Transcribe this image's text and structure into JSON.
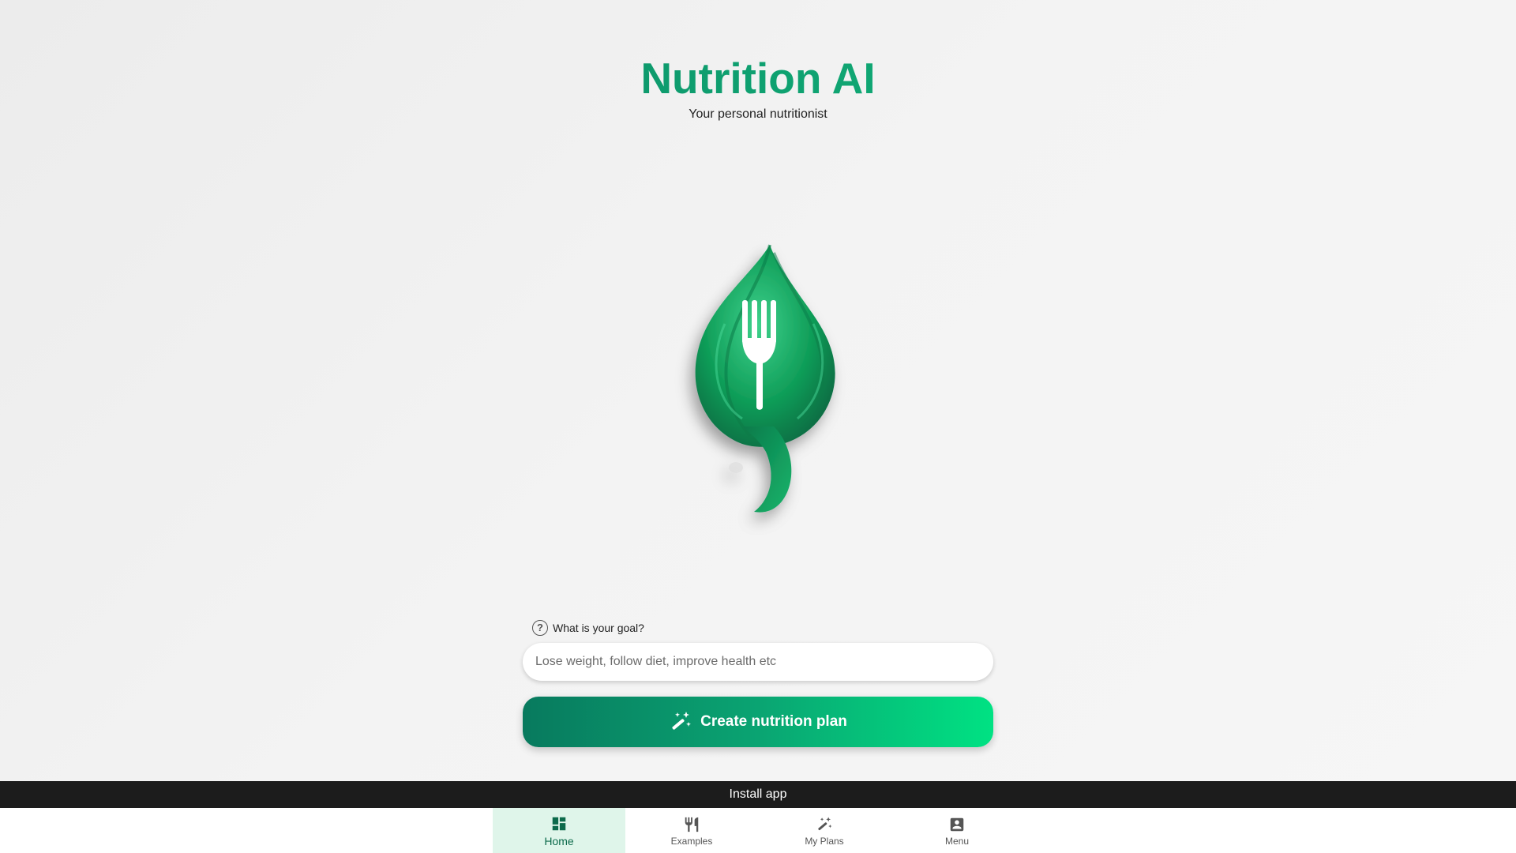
{
  "header": {
    "title": "Nutrition AI",
    "subtitle": "Your personal nutritionist"
  },
  "logo": {
    "icon": "leaf-fork-logo",
    "colors": {
      "primary": "#0f9d58",
      "dark": "#06623e",
      "light": "#3fd18c"
    }
  },
  "goal": {
    "label": "What is your goal?",
    "help_icon": "question-circle-icon",
    "input_placeholder": "Lose weight, follow diet, improve health etc",
    "input_value": ""
  },
  "create_button": {
    "label": "Create nutrition plan",
    "icon": "magic-wand-icon",
    "gradient": [
      "#087a5e",
      "#00e283"
    ]
  },
  "install_bar": {
    "label": "Install app"
  },
  "nav": {
    "items": [
      {
        "label": "Home",
        "icon": "dashboard-icon",
        "active": true
      },
      {
        "label": "Examples",
        "icon": "restaurant-icon",
        "active": false
      },
      {
        "label": "My Plans",
        "icon": "magic-wand-icon",
        "active": false
      },
      {
        "label": "Menu",
        "icon": "account-box-icon",
        "active": false
      }
    ]
  },
  "colors": {
    "accent": "#0aa472",
    "active_nav_bg": "#dff5ea",
    "install_bar_bg": "#1c1c1c"
  }
}
